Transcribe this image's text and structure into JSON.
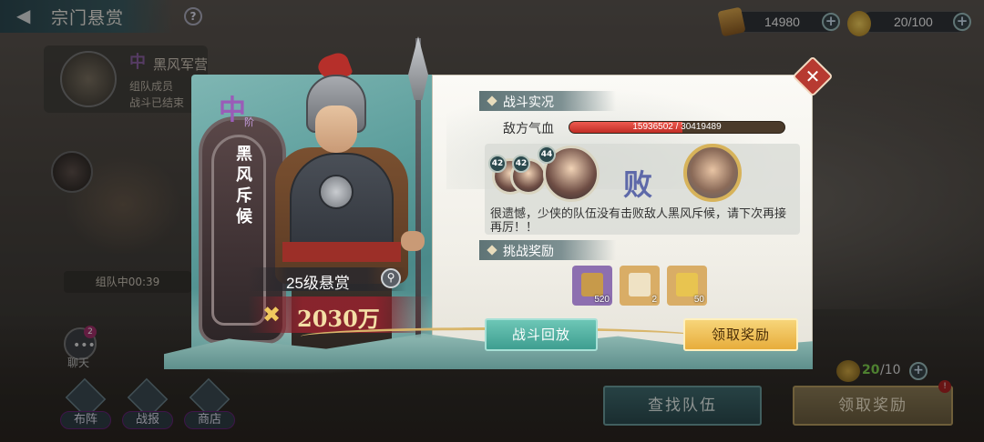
{
  "topbar": {
    "title": "宗门悬赏",
    "help_symbol": "?",
    "coins": "14980",
    "tokens": "20/100",
    "plus_symbol": "+"
  },
  "background": {
    "card_name": "黑风军营",
    "card_line1": "组队成员",
    "card_line2": "战斗已结束",
    "rank_char": "中",
    "team_timer": "组队中00:39",
    "chat_label": "聊天",
    "chat_badge": "2",
    "nav": [
      {
        "label": "布阵"
      },
      {
        "label": "战报"
      },
      {
        "label": "商店"
      }
    ],
    "find_team_label": "查找队伍",
    "claim_label": "领取奖励",
    "claim_badge": "!",
    "counter_current": "20",
    "counter_rest": "/10"
  },
  "modal": {
    "rank_char": "中",
    "rank_sub": "阶",
    "enemy_name": "黑风斥候",
    "bounty_level": "25级悬赏",
    "bounty_amount": "2030万",
    "battle_section_title": "战斗实况",
    "hp_label": "敌方气血",
    "hp_current": 15936502,
    "hp_max": 30419489,
    "hp_text": "15936502 / 30419489",
    "team_levels": [
      "42",
      "42",
      "44"
    ],
    "result": "败",
    "result_message": "很遗憾，少侠的队伍没有击败敌人黑风斥候，请下次再接再厉！！",
    "reward_section_title": "挑战奖励",
    "rewards": [
      {
        "name": "token",
        "qty": "520",
        "bg": "#8d6fb0",
        "glyph": "#c79a4a"
      },
      {
        "name": "scroll",
        "qty": "2",
        "bg": "#d9ad66",
        "glyph": "#efe2c4"
      },
      {
        "name": "gold-scroll",
        "qty": "50",
        "bg": "#d9ad66",
        "glyph": "#e8c450"
      }
    ],
    "replay_label": "战斗回放",
    "claim_label": "领取奖励"
  },
  "colors": {
    "accent_teal": "#3e9e90",
    "accent_gold": "#e7ad3b",
    "hp_red": "#c12d25",
    "close_red": "#b73a31"
  }
}
